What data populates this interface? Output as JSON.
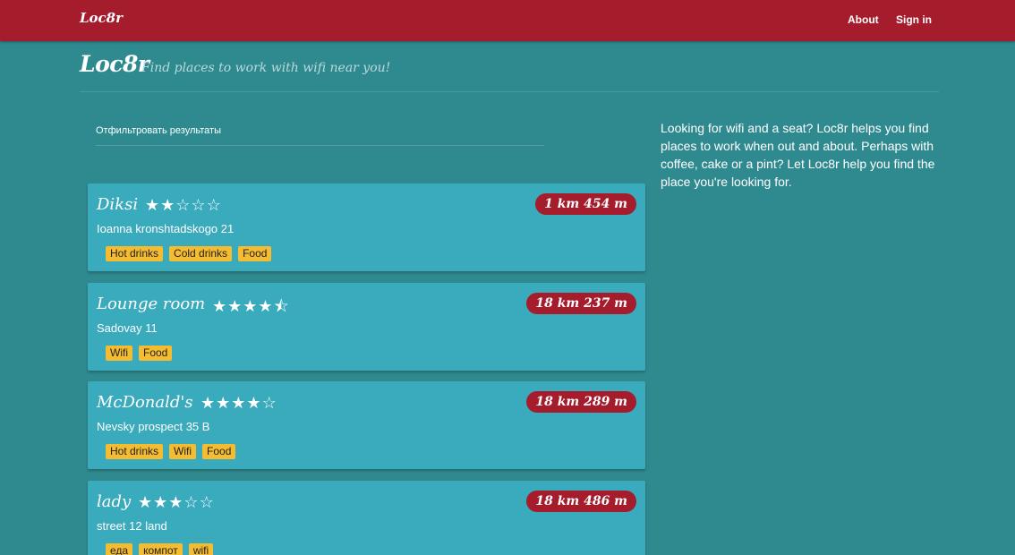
{
  "navbar": {
    "brand": "Loc8r",
    "links": [
      "About",
      "Sign in"
    ]
  },
  "header": {
    "title": "Loc8r",
    "subtitle": "Find places to work with wifi near you!"
  },
  "filter": {
    "label": "Отфильтровать результаты"
  },
  "sidebar": {
    "text": "Looking for wifi and a seat? Loc8r helps you find places to work when out and about. Perhaps with coffee, cake or a pint? Let Loc8r help you find the place you're looking for."
  },
  "locations": [
    {
      "name": "Diksi",
      "rating": 2,
      "address": "Ioanna kronshtadskogo 21",
      "distance": "1 km 454 m",
      "facilities": [
        "Hot drinks",
        "Cold drinks",
        "Food"
      ]
    },
    {
      "name": "Lounge room",
      "rating": 4.5,
      "address": "Sadovay 11",
      "distance": "18 km 237 m",
      "facilities": [
        "Wifi",
        "Food"
      ]
    },
    {
      "name": "McDonald's",
      "rating": 4,
      "address": "Nevsky prospect 35 B",
      "distance": "18 km 289 m",
      "facilities": [
        "Hot drinks",
        "Wifi",
        "Food"
      ]
    },
    {
      "name": "lady",
      "rating": 3,
      "address": "street 12 land",
      "distance": "18 km 486 m",
      "facilities": [
        "еда",
        "компот",
        "wifi"
      ]
    }
  ],
  "icons": {
    "star_full": "star-icon",
    "star_empty": "star-outline-icon",
    "star_half": "star-half-icon"
  },
  "colors": {
    "navbar": "#a51c2d",
    "background": "#2f8a90",
    "card": "#3aaabd",
    "tag": "#f5bc32",
    "distance_badge": "#a51c2d"
  }
}
